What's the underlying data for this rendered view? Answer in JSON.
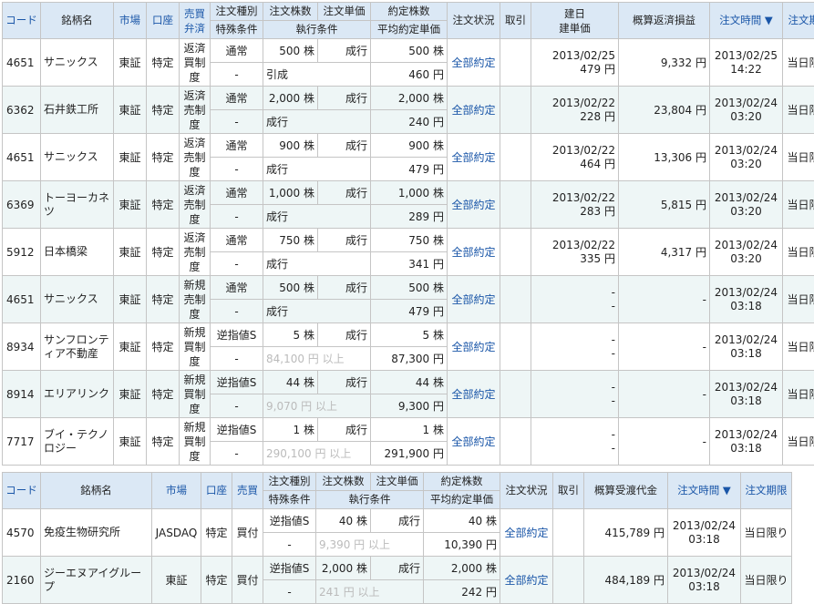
{
  "table1": {
    "headers": {
      "code": "コード",
      "name": "銘柄名",
      "market": "市場",
      "account": "口座",
      "kind1": "売買",
      "kind2": "弁済",
      "order_type": "注文種別",
      "special": "特殊条件",
      "order_qty": "注文株数",
      "exec_cond": "執行条件",
      "order_price": "注文単価",
      "filled_qty": "約定株数",
      "avg_price": "平均約定単価",
      "status": "注文状況",
      "cancel": "取引",
      "build1": "建日",
      "build2": "建単価",
      "pl": "概算返済損益",
      "order_time": "注文時間 ▼",
      "expiry": "注文期限"
    },
    "rows": [
      {
        "code": "4651",
        "name": "サニックス",
        "market": "東証",
        "account": "特定",
        "kind": "返済買制度",
        "order_type": "通常",
        "special": "-",
        "qty": "500 株",
        "exec": "引成",
        "price": "成行",
        "filled": "500 株",
        "avg": "460 円",
        "status": "全部約定",
        "build_date": "2013/02/25",
        "build_price": "479 円",
        "pl": "9,332 円",
        "time_date": "2013/02/25",
        "time_hm": "14:22",
        "expiry": "当日限り"
      },
      {
        "code": "6362",
        "name": "石井鉄工所",
        "market": "東証",
        "account": "特定",
        "kind": "返済売制度",
        "order_type": "通常",
        "special": "-",
        "qty": "2,000 株",
        "exec": "成行",
        "price": "成行",
        "filled": "2,000 株",
        "avg": "240 円",
        "status": "全部約定",
        "build_date": "2013/02/22",
        "build_price": "228 円",
        "pl": "23,804 円",
        "time_date": "2013/02/24",
        "time_hm": "03:20",
        "expiry": "当日限り"
      },
      {
        "code": "4651",
        "name": "サニックス",
        "market": "東証",
        "account": "特定",
        "kind": "返済売制度",
        "order_type": "通常",
        "special": "-",
        "qty": "900 株",
        "exec": "成行",
        "price": "成行",
        "filled": "900 株",
        "avg": "479 円",
        "status": "全部約定",
        "build_date": "2013/02/22",
        "build_price": "464 円",
        "pl": "13,306 円",
        "time_date": "2013/02/24",
        "time_hm": "03:20",
        "expiry": "当日限り"
      },
      {
        "code": "6369",
        "name": "トーヨーカネツ",
        "market": "東証",
        "account": "特定",
        "kind": "返済売制度",
        "order_type": "通常",
        "special": "-",
        "qty": "1,000 株",
        "exec": "成行",
        "price": "成行",
        "filled": "1,000 株",
        "avg": "289 円",
        "status": "全部約定",
        "build_date": "2013/02/22",
        "build_price": "283 円",
        "pl": "5,815 円",
        "time_date": "2013/02/24",
        "time_hm": "03:20",
        "expiry": "当日限り"
      },
      {
        "code": "5912",
        "name": "日本橋梁",
        "market": "東証",
        "account": "特定",
        "kind": "返済売制度",
        "order_type": "通常",
        "special": "-",
        "qty": "750 株",
        "exec": "成行",
        "price": "成行",
        "filled": "750 株",
        "avg": "341 円",
        "status": "全部約定",
        "build_date": "2013/02/22",
        "build_price": "335 円",
        "pl": "4,317 円",
        "time_date": "2013/02/24",
        "time_hm": "03:20",
        "expiry": "当日限り"
      },
      {
        "code": "4651",
        "name": "サニックス",
        "market": "東証",
        "account": "特定",
        "kind": "新規売制度",
        "order_type": "通常",
        "special": "-",
        "qty": "500 株",
        "exec": "成行",
        "price": "成行",
        "filled": "500 株",
        "avg": "479 円",
        "status": "全部約定",
        "build_date": "-",
        "build_price": "-",
        "pl": "-",
        "time_date": "2013/02/24",
        "time_hm": "03:18",
        "expiry": "当日限り"
      },
      {
        "code": "8934",
        "name": "サンフロンティア不動産",
        "market": "東証",
        "account": "特定",
        "kind": "新規買制度",
        "order_type": "逆指値S",
        "special": "-",
        "qty": "5 株",
        "exec": "84,100 円 以上",
        "price": "成行",
        "filled": "5 株",
        "avg": "87,300 円",
        "status": "全部約定",
        "build_date": "-",
        "build_price": "-",
        "pl": "-",
        "time_date": "2013/02/24",
        "time_hm": "03:18",
        "expiry": "当日限り"
      },
      {
        "code": "8914",
        "name": "エリアリンク",
        "market": "東証",
        "account": "特定",
        "kind": "新規買制度",
        "order_type": "逆指値S",
        "special": "-",
        "qty": "44 株",
        "exec": "9,070 円 以上",
        "price": "成行",
        "filled": "44 株",
        "avg": "9,300 円",
        "status": "全部約定",
        "build_date": "-",
        "build_price": "-",
        "pl": "-",
        "time_date": "2013/02/24",
        "time_hm": "03:18",
        "expiry": "当日限り"
      },
      {
        "code": "7717",
        "name": "ブイ・テクノロジー",
        "market": "東証",
        "account": "特定",
        "kind": "新規買制度",
        "order_type": "逆指値S",
        "special": "-",
        "qty": "1 株",
        "exec": "290,100 円 以上",
        "price": "成行",
        "filled": "1 株",
        "avg": "291,900 円",
        "status": "全部約定",
        "build_date": "-",
        "build_price": "-",
        "pl": "-",
        "time_date": "2013/02/24",
        "time_hm": "03:18",
        "expiry": "当日限り"
      }
    ]
  },
  "table2": {
    "headers": {
      "code": "コード",
      "name": "銘柄名",
      "market": "市場",
      "account": "口座",
      "kind": "売買",
      "order_type": "注文種別",
      "special": "特殊条件",
      "order_qty": "注文株数",
      "exec_cond": "執行条件",
      "order_price": "注文単価",
      "filled_qty": "約定株数",
      "avg_price": "平均約定単価",
      "status": "注文状況",
      "cancel": "取引",
      "amount": "概算受渡代金",
      "order_time": "注文時間 ▼",
      "expiry": "注文期限"
    },
    "rows": [
      {
        "code": "4570",
        "name": "免疫生物研究所",
        "market": "JASDAQ",
        "account": "特定",
        "kind": "買付",
        "order_type": "逆指値S",
        "special": "-",
        "qty": "40 株",
        "exec": "9,390 円 以上",
        "price": "成行",
        "filled": "40 株",
        "avg": "10,390 円",
        "status": "全部約定",
        "amount": "415,789 円",
        "time_date": "2013/02/24",
        "time_hm": "03:18",
        "expiry": "当日限り"
      },
      {
        "code": "2160",
        "name": "ジーエヌアイグループ",
        "market": "東証",
        "account": "特定",
        "kind": "買付",
        "order_type": "逆指値S",
        "special": "-",
        "qty": "2,000 株",
        "exec": "241 円 以上",
        "price": "成行",
        "filled": "2,000 株",
        "avg": "242 円",
        "status": "全部約定",
        "amount": "484,189 円",
        "time_date": "2013/02/24",
        "time_hm": "03:18",
        "expiry": "当日限り"
      }
    ]
  }
}
